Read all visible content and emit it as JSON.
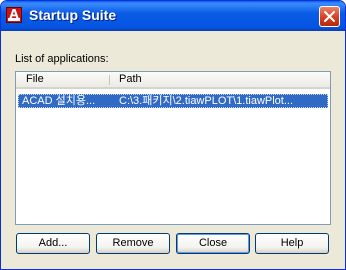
{
  "window": {
    "title": "Startup Suite"
  },
  "list": {
    "label": "List of applications:",
    "columns": {
      "file": "File",
      "path": "Path"
    },
    "rows": [
      {
        "file": "ACAD 설치용...",
        "path": "C:\\3.패키지\\2.tiawPLOT\\1.tiawPlot..."
      }
    ]
  },
  "buttons": {
    "add": "Add...",
    "remove": "Remove",
    "close": "Close",
    "help": "Help"
  },
  "colors": {
    "titlebar": "#0554e3",
    "selection": "#316ac5",
    "dialog_bg": "#ece9d8"
  }
}
